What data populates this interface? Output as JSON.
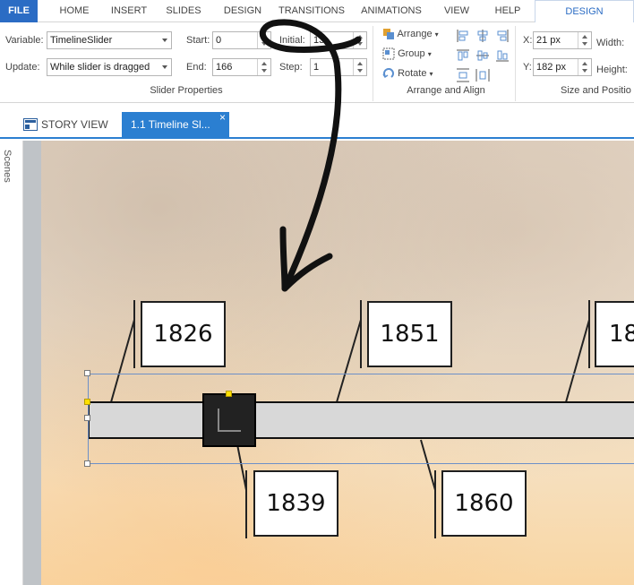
{
  "ribbon_tabs": {
    "file": "FILE",
    "home": "HOME",
    "insert": "INSERT",
    "slides": "SLIDES",
    "design": "DESIGN",
    "transitions": "TRANSITIONS",
    "animations": "ANIMATIONS",
    "view": "VIEW",
    "help": "HELP",
    "context_design": "DESIGN"
  },
  "slider_properties": {
    "variable_label": "Variable:",
    "variable_value": "TimelineSlider",
    "update_label": "Update:",
    "update_value": "While slider is dragged",
    "start_label": "Start:",
    "start_value": "0",
    "end_label": "End:",
    "end_value": "166",
    "initial_label": "Initial:",
    "initial_value": "13",
    "step_label": "Step:",
    "step_value": "1",
    "group_title": "Slider Properties"
  },
  "arrange_align": {
    "arrange": "Arrange",
    "group": "Group",
    "rotate": "Rotate",
    "group_title": "Arrange and Align"
  },
  "size_position": {
    "x_label": "X:",
    "x_value": "21 px",
    "y_label": "Y:",
    "y_value": "182 px",
    "width_label": "Width:",
    "height_label": "Height:",
    "group_title": "Size and Positio"
  },
  "document_tabs": {
    "story_view": "STORY VIEW",
    "active_tab": "1.1 Timeline Sl...",
    "close": "×"
  },
  "scenes_panel": {
    "label": "Scenes"
  },
  "timeline": {
    "top_years": [
      "1826",
      "1851",
      "18"
    ],
    "bottom_years": [
      "1839",
      "1860"
    ]
  },
  "colors": {
    "accent": "#2b7fd1",
    "file_tab": "#2b6cc4",
    "slider_track": "#d8d8d8",
    "slider_thumb": "#222222"
  }
}
